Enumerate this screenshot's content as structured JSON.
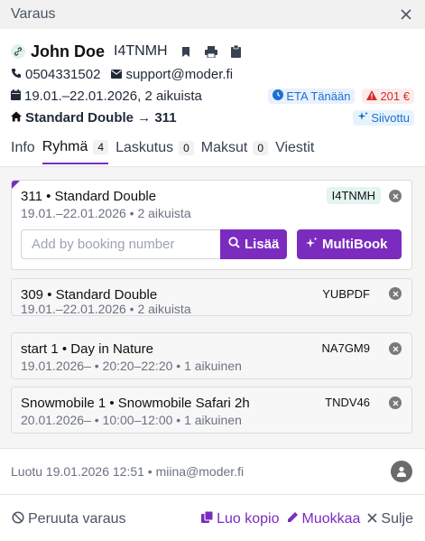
{
  "window": {
    "title": "Varaus"
  },
  "booking": {
    "guest_name": "John Doe",
    "code": "I4TNMH",
    "phone": "0504331502",
    "email": "support@moder.fi",
    "dates": "19.01.–22.01.2026, 2 aikuista",
    "room": "Standard Double → 311",
    "eta_label": "ETA Tänään",
    "balance_label": "201 €",
    "cleaning_label": "Siivottu"
  },
  "tabs": [
    {
      "label": "Info"
    },
    {
      "label": "Ryhmä",
      "count": "4"
    },
    {
      "label": "Laskutus",
      "count": "0"
    },
    {
      "label": "Maksut",
      "count": "0"
    },
    {
      "label": "Viestit"
    }
  ],
  "group": {
    "add_placeholder": "Add by booking number",
    "add_button": "Lisää",
    "multibook_button": "MultiBook",
    "items": [
      {
        "title": "311 • Standard Double",
        "subtitle": "19.01.–22.01.2026 • 2 aikuista",
        "code": "I4TNMH"
      },
      {
        "title": "309 • Standard Double",
        "subtitle": "19.01.–22.01.2026 • 2 aikuista",
        "code": "YUBPDF"
      },
      {
        "title": "start 1 • Day in Nature",
        "subtitle": "19.01.2026– • 20:20–22:20 • 1 aikuinen",
        "code": "NA7GM9"
      },
      {
        "title": "Snowmobile 1 • Snowmobile Safari 2h",
        "subtitle": "20.01.2026– • 10:00–12:00 • 1 aikuinen",
        "code": "TNDV46"
      }
    ]
  },
  "meta": {
    "created": "Luotu 19.01.2026 12:51 • miina@moder.fi"
  },
  "actions": {
    "cancel": "Peruuta varaus",
    "copy": "Luo kopio",
    "edit": "Muokkaa",
    "close": "Sulje"
  },
  "colors": {
    "accent": "#7b2cbf",
    "danger": "#d42c2c",
    "info": "#1d6fd1"
  },
  "icons": [
    "close-icon",
    "link-icon",
    "bookmark-icon",
    "printer-icon",
    "clipboard-icon",
    "phone-icon",
    "mail-icon",
    "calendar-icon",
    "home-icon",
    "clock-icon",
    "warning-icon",
    "sparkle-icon",
    "search-icon",
    "remove-icon",
    "user-icon",
    "ban-icon",
    "copy-icon",
    "pencil-icon"
  ]
}
